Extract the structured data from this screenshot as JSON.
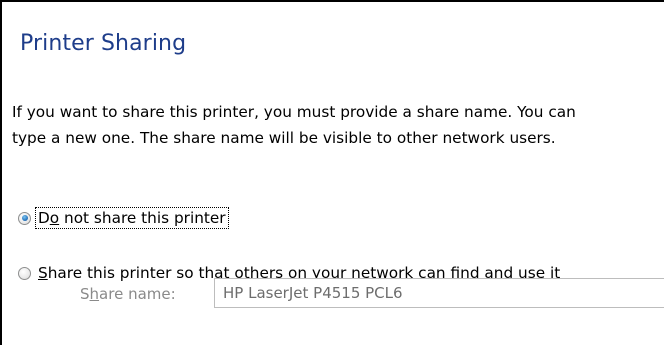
{
  "dialog": {
    "title": "Printer Sharing",
    "description_line1": "If you want to share this printer, you must provide a share name. You can",
    "description_line2": "type a new one. The share name will be visible to other network users."
  },
  "options": [
    {
      "pre": "D",
      "mnemonic": "o",
      "post": " not share this printer",
      "selected": true
    },
    {
      "pre": "",
      "mnemonic": "S",
      "post": "hare this printer so that others on your network can find and use it",
      "selected": false
    }
  ],
  "share_name": {
    "label_pre": "S",
    "label_mnemonic": "h",
    "label_post": "are name:",
    "value": "HP LaserJet P4515 PCL6",
    "enabled": false
  }
}
